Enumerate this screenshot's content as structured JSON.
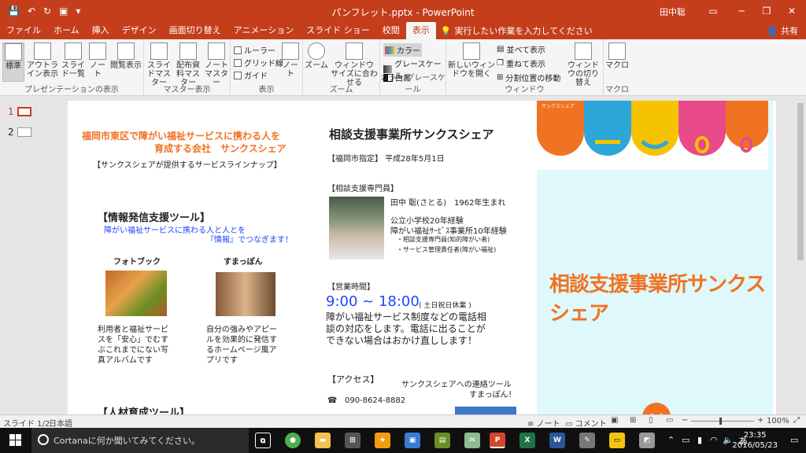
{
  "titlebar": {
    "title": "パンフレット.pptx - PowerPoint",
    "user": "田中聡"
  },
  "tabs": [
    "ファイル",
    "ホーム",
    "挿入",
    "デザイン",
    "画面切り替え",
    "アニメーション",
    "スライド ショー",
    "校閲",
    "表示"
  ],
  "active_tab": "表示",
  "tell_me": "実行したい作業を入力してください",
  "share_label": "共有",
  "ribbon": {
    "presentation_views": {
      "label": "プレゼンテーションの表示",
      "buttons": [
        "標準",
        "アウトライン表示",
        "スライド一覧",
        "ノート",
        "閲覧表示"
      ]
    },
    "master_views": {
      "label": "マスター表示",
      "buttons": [
        "スライドマスター",
        "配布資料マスター",
        "ノートマスター"
      ]
    },
    "show": {
      "label": "表示",
      "checks": [
        "ルーラー",
        "グリッド線",
        "ガイド"
      ],
      "notes": "ノート"
    },
    "zoom": {
      "label": "ズーム",
      "buttons": [
        "ズーム",
        "ウィンドウ サイズに合わせる"
      ]
    },
    "color": {
      "label": "カラー/グレースケール",
      "options": [
        "カラー",
        "グレースケール",
        "白黒"
      ]
    },
    "window": {
      "label": "ウィンドウ",
      "new_window": "新しいウィンドウを開く",
      "arrange": "並べて表示",
      "cascade": "重ねて表示",
      "move_split": "分割位置の移動",
      "switch": "ウィンドウの切り替え"
    },
    "macro": {
      "label": "マクロ",
      "button": "マクロ"
    }
  },
  "thumbnails": [
    "1",
    "2"
  ],
  "slide": {
    "left_header_1": "福岡市東区で障がい福祉サービスに携わる人を",
    "left_header_2": "育成する会社　サンクスシェア",
    "lineup": "【サンクスシェアが提供するサービスラインナップ】",
    "info_tool_title": "【情報発信支援ツール】",
    "info_tool_sub1": "障がい福祉サービスに携わる人と人とを",
    "info_tool_sub2": "『情報』でつなぎます！",
    "photobook_title": "フォトブック",
    "photobook_desc": [
      "利用者と福祉サービ",
      "スを「安心」でむす",
      "ぶこれまでにない写",
      "真アルバムです"
    ],
    "sumappon_title": "すまっぽん",
    "sumappon_desc": [
      "自分の強みやアピー",
      "ルを効果的に発信す",
      "るホームページ風ア",
      "プリです"
    ],
    "bottom_cut": "【人材育成ツール】",
    "center_title": "相談支援事業所サンクスシェア",
    "designation": "【福岡市指定】 平成28年5月1日",
    "staff_head": "【相談支援専門員】",
    "staff_name": "田中 聡(さとる)　1962年生まれ",
    "staff_l1": "公立小学校20年経験",
    "staff_l2": "障がい福祉ｻｰﾋﾞｽ事業所10年経験",
    "staff_l3": "・相談支援専門員(知的障がい者)",
    "staff_l4": "・サービス管理責任者(障がい福祉)",
    "hours_head": "【営業時間】",
    "hours": "9:00 ~ 18:00",
    "hours_note": "( 土日祝日休業 )",
    "hours_desc": [
      "障がい福祉サービス制度などの電話相",
      "談の対応をします。電話に出ることが",
      "できない場合はおかけ直しします！"
    ],
    "access_head": "【アクセス】",
    "contact_tool_1": "サンクスシェアへの連絡ツール",
    "contact_tool_2": "すまっぽん！",
    "phone": "090-8624-8882",
    "logo_small": "サンクスシェア",
    "right_title": "相談支援事業所サンクスシェア",
    "face_colors": [
      "#f07322",
      "#2ca7d8",
      "#f6c300",
      "#e84a8a",
      "#f07322"
    ]
  },
  "statusbar": {
    "slide": "スライド 1/2",
    "language": "日本語",
    "notes": "ノート",
    "comments": "コメント",
    "zoom": "100%"
  },
  "taskbar": {
    "search_placeholder": "Cortanaに何か聞いてみてください。",
    "time": "23:35",
    "date": "2016/05/23",
    "ime": "あ"
  },
  "colors": {
    "accent": "#c43e1c",
    "orange": "#f07322",
    "cyan": "#dff8fb",
    "link_blue": "#1e46ff"
  }
}
